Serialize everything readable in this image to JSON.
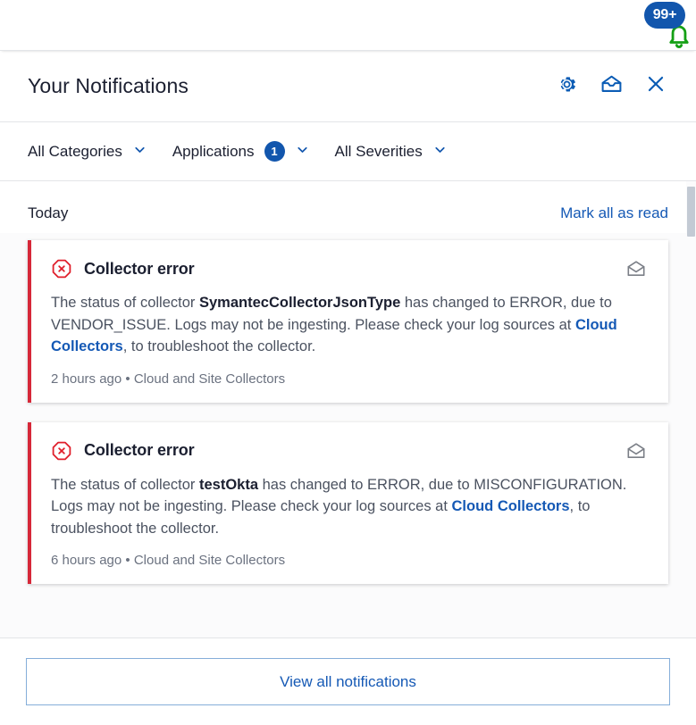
{
  "bell": {
    "badge_count": "99+",
    "badge_color": "#1256ad",
    "bell_color": "#15a015",
    "icon": "bell-icon"
  },
  "header": {
    "title": "Your Notifications",
    "actions": [
      {
        "name": "settings-button",
        "icon": "gear-icon"
      },
      {
        "name": "archive-button",
        "icon": "inbox-tray-icon"
      },
      {
        "name": "close-button",
        "icon": "close-icon"
      }
    ],
    "icon_color": "#0b5cb5"
  },
  "filters": [
    {
      "label": "All Categories",
      "count": "",
      "icon": "chevron-down-icon"
    },
    {
      "label": "Applications",
      "count": "1",
      "icon": "chevron-down-icon"
    },
    {
      "label": "All Severities",
      "count": "",
      "icon": "chevron-down-icon"
    }
  ],
  "section": {
    "title": "Today",
    "mark_all_label": "Mark all as read"
  },
  "notifications": [
    {
      "severity": "error",
      "severity_icon": "error-octagon-icon",
      "accent_color": "#d62839",
      "title": "Collector error",
      "body_pre": "The status of collector ",
      "body_bold": "SymantecCollectorJsonType",
      "body_mid": " has changed to ERROR, due to VENDOR_ISSUE. Logs may not be ingesting. Please check your log sources at ",
      "body_link": "Cloud Collectors",
      "body_post": ", to troubleshoot the collector.",
      "time": "2 hours ago",
      "separator": "•",
      "source": "Cloud and Site Collectors",
      "action_icon": "open-envelope-icon"
    },
    {
      "severity": "error",
      "severity_icon": "error-octagon-icon",
      "accent_color": "#d62839",
      "title": "Collector error",
      "body_pre": "The status of collector ",
      "body_bold": "testOkta",
      "body_mid": " has changed to ERROR, due to MISCONFIGURATION. Logs may not be ingesting. Please check your log sources at ",
      "body_link": "Cloud Collectors",
      "body_post": ", to troubleshoot the collector.",
      "time": "6 hours ago",
      "separator": "•",
      "source": "Cloud and Site Collectors",
      "action_icon": "open-envelope-icon"
    }
  ],
  "footer": {
    "view_all_label": "View all notifications"
  },
  "colors": {
    "link": "#1559b5",
    "accent_blue": "#1256ad",
    "error_red": "#d62839",
    "green": "#15a015"
  }
}
